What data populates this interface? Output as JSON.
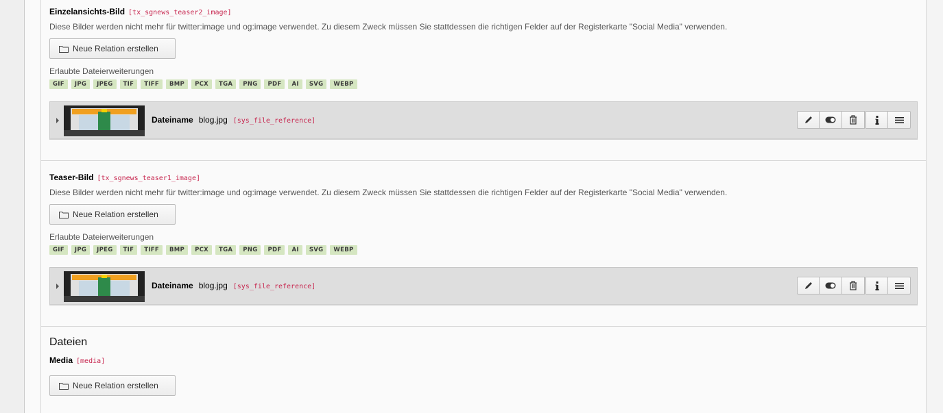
{
  "sections": [
    {
      "title": "Einzelansichts-Bild",
      "key": "[tx_sgnews_teaser2_image]",
      "description": "Diese Bilder werden nicht mehr für twitter:image und og:image verwendet. Zu diesem Zweck müssen Sie stattdessen die richtigen Felder auf der Registerkarte \"Social Media\" verwenden.",
      "button_label": "Neue Relation erstellen",
      "extensions_label": "Erlaubte Dateierweiterungen",
      "extensions": [
        "GIF",
        "JPG",
        "JPEG",
        "TIF",
        "TIFF",
        "BMP",
        "PCX",
        "TGA",
        "PNG",
        "PDF",
        "AI",
        "SVG",
        "WEBP"
      ],
      "reference": {
        "label": "Dateiname",
        "filename": "blog.jpg",
        "table": "[sys_file_reference]"
      }
    },
    {
      "title": "Teaser-Bild",
      "key": "[tx_sgnews_teaser1_image]",
      "description": "Diese Bilder werden nicht mehr für twitter:image und og:image verwendet. Zu diesem Zweck müssen Sie stattdessen die richtigen Felder auf der Registerkarte \"Social Media\" verwenden.",
      "button_label": "Neue Relation erstellen",
      "extensions_label": "Erlaubte Dateierweiterungen",
      "extensions": [
        "GIF",
        "JPG",
        "JPEG",
        "TIF",
        "TIFF",
        "BMP",
        "PCX",
        "TGA",
        "PNG",
        "PDF",
        "AI",
        "SVG",
        "WEBP"
      ],
      "reference": {
        "label": "Dateiname",
        "filename": "blog.jpg",
        "table": "[sys_file_reference]"
      }
    }
  ],
  "files_section": {
    "heading": "Dateien",
    "title": "Media",
    "key": "[media]",
    "button_label": "Neue Relation erstellen"
  },
  "controls": [
    "pencil-icon",
    "toggle-icon",
    "trash-icon",
    "info-icon",
    "drag-handle-icon"
  ],
  "colors": {
    "field_key": "#c7254e",
    "extension_badge": "#d5e6c1",
    "reference_bg": "#dedede"
  }
}
